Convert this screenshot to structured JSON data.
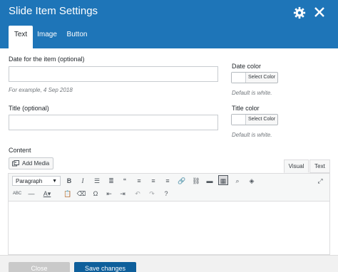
{
  "header": {
    "title": "Slide Item Settings",
    "tabs": [
      "Text",
      "Image",
      "Button"
    ]
  },
  "form": {
    "date_label": "Date for the item (optional)",
    "date_value": "",
    "date_hint": "For example, 4 Sep 2018",
    "title_label": "Title (optional)",
    "title_value": "",
    "date_color_label": "Date color",
    "title_color_label": "Title color",
    "select_color": "Select Color",
    "color_hint": "Default is white.",
    "content_label": "Content",
    "add_media": "Add Media"
  },
  "editor": {
    "tabs": [
      "Visual",
      "Text"
    ],
    "format": "Paragraph",
    "icons_row1": [
      "bold-icon",
      "italic-icon",
      "bullet-list-icon",
      "numbered-list-icon",
      "blockquote-icon",
      "align-left-icon",
      "align-center-icon",
      "align-right-icon",
      "link-icon",
      "unlink-icon",
      "read-more-icon",
      "toolbar-toggle-icon",
      "search-icon",
      "layers-icon",
      "fullscreen-icon"
    ],
    "icons_row2": [
      "strikethrough-icon",
      "horizontal-line-icon",
      "text-color-icon",
      "paste-text-icon",
      "clear-formatting-icon",
      "special-character-icon",
      "outdent-icon",
      "indent-icon",
      "undo-icon",
      "redo-icon",
      "help-icon"
    ]
  },
  "footer": {
    "close": "Close",
    "save": "Save changes"
  },
  "colors": {
    "header": "#1e75b8",
    "save": "#0e5f9b"
  }
}
